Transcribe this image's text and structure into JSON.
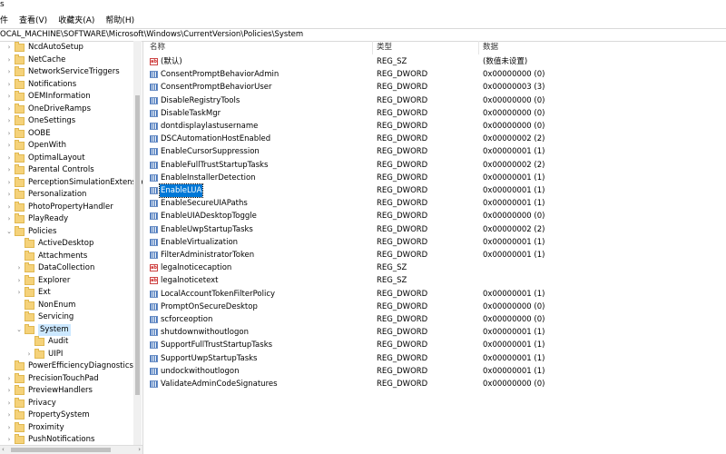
{
  "title_fragment": "s",
  "menu": [
    "查看(V)",
    "收藏夹(A)",
    "帮助(H)"
  ],
  "menu_first_partial": "件",
  "address": "OCAL_MACHINE\\SOFTWARE\\Microsoft\\Windows\\CurrentVersion\\Policies\\System",
  "tree": {
    "items": [
      {
        "label": "NcdAutoSetup",
        "level": 1,
        "exp": ">"
      },
      {
        "label": "NetCache",
        "level": 1,
        "exp": ">"
      },
      {
        "label": "NetworkServiceTriggers",
        "level": 1,
        "exp": ">"
      },
      {
        "label": "Notifications",
        "level": 1,
        "exp": ">"
      },
      {
        "label": "OEMInformation",
        "level": 1,
        "exp": ">"
      },
      {
        "label": "OneDriveRamps",
        "level": 1,
        "exp": ">"
      },
      {
        "label": "OneSettings",
        "level": 1,
        "exp": ">"
      },
      {
        "label": "OOBE",
        "level": 1,
        "exp": ">"
      },
      {
        "label": "OpenWith",
        "level": 1,
        "exp": ">"
      },
      {
        "label": "OptimalLayout",
        "level": 1,
        "exp": ">"
      },
      {
        "label": "Parental Controls",
        "level": 1,
        "exp": ">"
      },
      {
        "label": "PerceptionSimulationExtensio",
        "level": 1,
        "exp": ">"
      },
      {
        "label": "Personalization",
        "level": 1,
        "exp": ">"
      },
      {
        "label": "PhotoPropertyHandler",
        "level": 1,
        "exp": ">"
      },
      {
        "label": "PlayReady",
        "level": 1,
        "exp": ">"
      },
      {
        "label": "Policies",
        "level": 1,
        "exp": "v"
      },
      {
        "label": "ActiveDesktop",
        "level": 2,
        "exp": ""
      },
      {
        "label": "Attachments",
        "level": 2,
        "exp": ""
      },
      {
        "label": "DataCollection",
        "level": 2,
        "exp": ">"
      },
      {
        "label": "Explorer",
        "level": 2,
        "exp": ">"
      },
      {
        "label": "Ext",
        "level": 2,
        "exp": ">"
      },
      {
        "label": "NonEnum",
        "level": 2,
        "exp": ""
      },
      {
        "label": "Servicing",
        "level": 2,
        "exp": ""
      },
      {
        "label": "System",
        "level": 2,
        "exp": "v",
        "selected": true
      },
      {
        "label": "Audit",
        "level": 3,
        "exp": ""
      },
      {
        "label": "UIPI",
        "level": 3,
        "exp": ">"
      },
      {
        "label": "PowerEfficiencyDiagnostics",
        "level": 1,
        "exp": ""
      },
      {
        "label": "PrecisionTouchPad",
        "level": 1,
        "exp": ">"
      },
      {
        "label": "PreviewHandlers",
        "level": 1,
        "exp": ">"
      },
      {
        "label": "Privacy",
        "level": 1,
        "exp": ">"
      },
      {
        "label": "PropertySystem",
        "level": 1,
        "exp": ">"
      },
      {
        "label": "Proximity",
        "level": 1,
        "exp": ">"
      },
      {
        "label": "PushNotifications",
        "level": 1,
        "exp": ">"
      }
    ]
  },
  "list": {
    "headers": {
      "name": "名称",
      "type": "类型",
      "data": "数据"
    },
    "rows": [
      {
        "icon": "string-value-icon",
        "name": "(默认)",
        "type": "REG_SZ",
        "data": "(数值未设置)"
      },
      {
        "icon": "dword-value-icon",
        "name": "ConsentPromptBehaviorAdmin",
        "type": "REG_DWORD",
        "data": "0x00000000 (0)"
      },
      {
        "icon": "dword-value-icon",
        "name": "ConsentPromptBehaviorUser",
        "type": "REG_DWORD",
        "data": "0x00000003 (3)"
      },
      {
        "icon": "dword-value-icon",
        "name": "DisableRegistryTools",
        "type": "REG_DWORD",
        "data": "0x00000000 (0)"
      },
      {
        "icon": "dword-value-icon",
        "name": "DisableTaskMgr",
        "type": "REG_DWORD",
        "data": "0x00000000 (0)"
      },
      {
        "icon": "dword-value-icon",
        "name": "dontdisplaylastusername",
        "type": "REG_DWORD",
        "data": "0x00000000 (0)"
      },
      {
        "icon": "dword-value-icon",
        "name": "DSCAutomationHostEnabled",
        "type": "REG_DWORD",
        "data": "0x00000002 (2)"
      },
      {
        "icon": "dword-value-icon",
        "name": "EnableCursorSuppression",
        "type": "REG_DWORD",
        "data": "0x00000001 (1)"
      },
      {
        "icon": "dword-value-icon",
        "name": "EnableFullTrustStartupTasks",
        "type": "REG_DWORD",
        "data": "0x00000002 (2)"
      },
      {
        "icon": "dword-value-icon",
        "name": "EnableInstallerDetection",
        "type": "REG_DWORD",
        "data": "0x00000001 (1)"
      },
      {
        "icon": "dword-value-icon",
        "name": "EnableLUA",
        "type": "REG_DWORD",
        "data": "0x00000001 (1)",
        "selected": true
      },
      {
        "icon": "dword-value-icon",
        "name": "EnableSecureUIAPaths",
        "type": "REG_DWORD",
        "data": "0x00000001 (1)"
      },
      {
        "icon": "dword-value-icon",
        "name": "EnableUIADesktopToggle",
        "type": "REG_DWORD",
        "data": "0x00000000 (0)"
      },
      {
        "icon": "dword-value-icon",
        "name": "EnableUwpStartupTasks",
        "type": "REG_DWORD",
        "data": "0x00000002 (2)"
      },
      {
        "icon": "dword-value-icon",
        "name": "EnableVirtualization",
        "type": "REG_DWORD",
        "data": "0x00000001 (1)"
      },
      {
        "icon": "dword-value-icon",
        "name": "FilterAdministratorToken",
        "type": "REG_DWORD",
        "data": "0x00000001 (1)"
      },
      {
        "icon": "string-value-icon",
        "name": "legalnoticecaption",
        "type": "REG_SZ",
        "data": ""
      },
      {
        "icon": "string-value-icon",
        "name": "legalnoticetext",
        "type": "REG_SZ",
        "data": ""
      },
      {
        "icon": "dword-value-icon",
        "name": "LocalAccountTokenFilterPolicy",
        "type": "REG_DWORD",
        "data": "0x00000001 (1)"
      },
      {
        "icon": "dword-value-icon",
        "name": "PromptOnSecureDesktop",
        "type": "REG_DWORD",
        "data": "0x00000000 (0)"
      },
      {
        "icon": "dword-value-icon",
        "name": "scforceoption",
        "type": "REG_DWORD",
        "data": "0x00000000 (0)"
      },
      {
        "icon": "dword-value-icon",
        "name": "shutdownwithoutlogon",
        "type": "REG_DWORD",
        "data": "0x00000001 (1)"
      },
      {
        "icon": "dword-value-icon",
        "name": "SupportFullTrustStartupTasks",
        "type": "REG_DWORD",
        "data": "0x00000001 (1)"
      },
      {
        "icon": "dword-value-icon",
        "name": "SupportUwpStartupTasks",
        "type": "REG_DWORD",
        "data": "0x00000001 (1)"
      },
      {
        "icon": "dword-value-icon",
        "name": "undockwithoutlogon",
        "type": "REG_DWORD",
        "data": "0x00000001 (1)"
      },
      {
        "icon": "dword-value-icon",
        "name": "ValidateAdminCodeSignatures",
        "type": "REG_DWORD",
        "data": "0x00000000 (0)"
      }
    ]
  }
}
